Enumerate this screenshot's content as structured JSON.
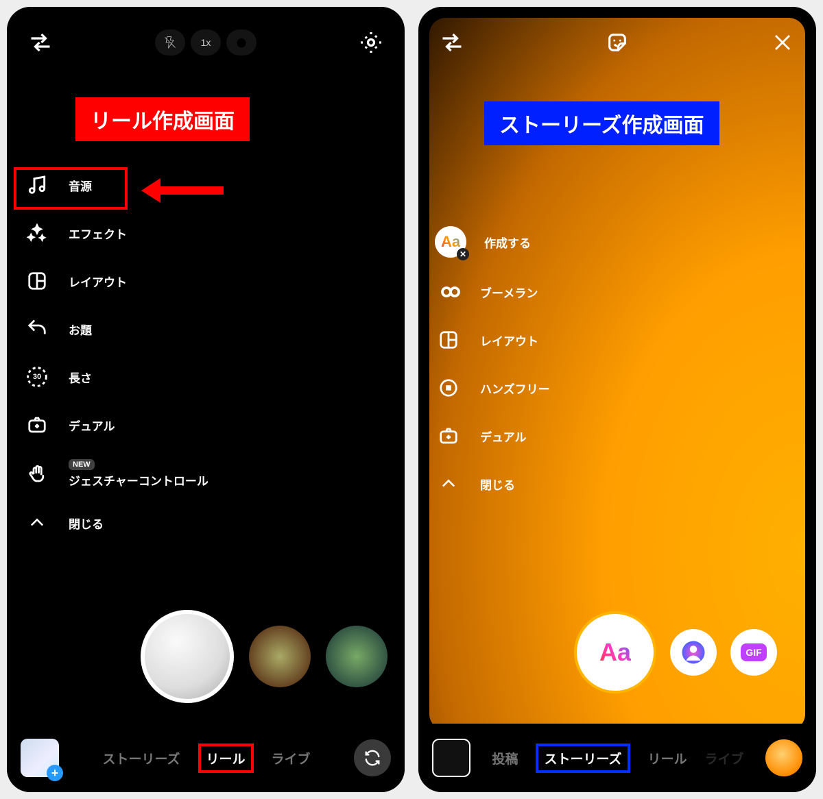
{
  "left": {
    "annotation": "リール作成画面",
    "topPills": {
      "zoom": "1x"
    },
    "options": [
      {
        "key": "audio",
        "label": "音源"
      },
      {
        "key": "effect",
        "label": "エフェクト"
      },
      {
        "key": "layout",
        "label": "レイアウト"
      },
      {
        "key": "topic",
        "label": "お題"
      },
      {
        "key": "length",
        "label": "長さ",
        "badge_inner": "30"
      },
      {
        "key": "dual",
        "label": "デュアル"
      },
      {
        "key": "gesture",
        "label": "ジェスチャーコントロール",
        "badge": "NEW"
      },
      {
        "key": "close",
        "label": "閉じる"
      }
    ],
    "tabs": {
      "stories": "ストーリーズ",
      "reel": "リール",
      "live": "ライブ",
      "active": "reel"
    }
  },
  "right": {
    "annotation": "ストーリーズ作成画面",
    "options": [
      {
        "key": "create",
        "label": "作成する"
      },
      {
        "key": "boomerang",
        "label": "ブーメラン"
      },
      {
        "key": "layout",
        "label": "レイアウト"
      },
      {
        "key": "handsfree",
        "label": "ハンズフリー"
      },
      {
        "key": "dual",
        "label": "デュアル"
      },
      {
        "key": "close",
        "label": "閉じる"
      }
    ],
    "effects": {
      "main": "Aa",
      "gif": "GIF"
    },
    "tabs": {
      "post": "投稿",
      "stories": "ストーリーズ",
      "reel": "リール",
      "live": "ライブ",
      "active": "stories"
    }
  }
}
